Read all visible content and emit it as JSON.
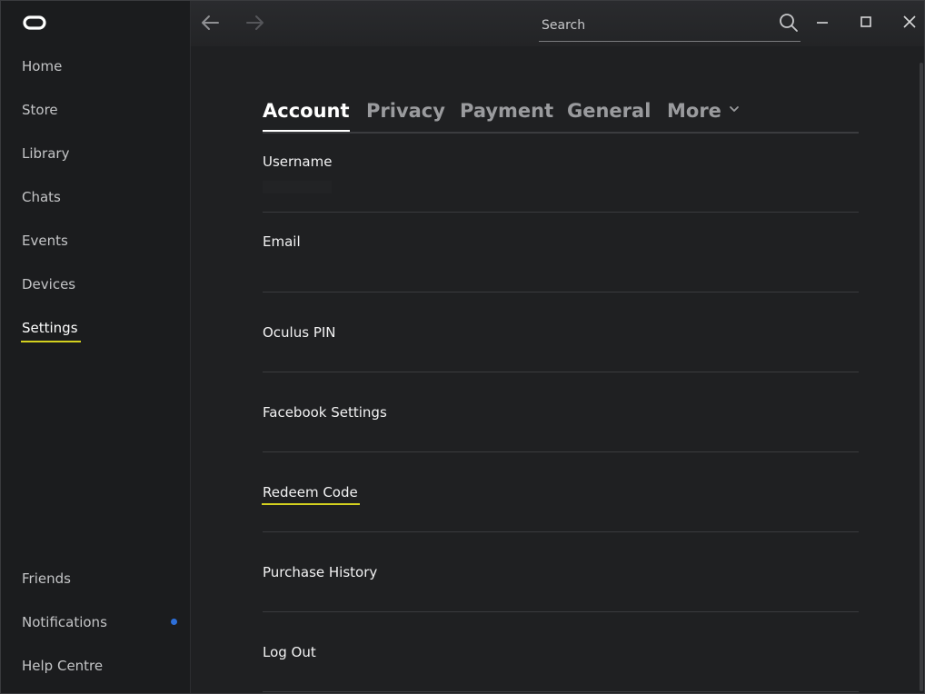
{
  "sidebar": {
    "logo": "oculus-logo",
    "items": [
      {
        "label": "Home"
      },
      {
        "label": "Store"
      },
      {
        "label": "Library"
      },
      {
        "label": "Chats"
      },
      {
        "label": "Events"
      },
      {
        "label": "Devices"
      },
      {
        "label": "Settings",
        "active": true
      }
    ],
    "bottom_items": [
      {
        "label": "Friends"
      },
      {
        "label": "Notifications",
        "has_badge": true
      },
      {
        "label": "Help Centre"
      }
    ]
  },
  "topbar": {
    "back_icon": "arrow-left-icon",
    "forward_icon": "arrow-right-icon",
    "search": {
      "placeholder": "Search",
      "value": ""
    },
    "window_controls": [
      "minimize-icon",
      "maximize-icon",
      "close-icon"
    ]
  },
  "tabs": [
    {
      "label": "Account",
      "active": true
    },
    {
      "label": "Privacy"
    },
    {
      "label": "Payment"
    },
    {
      "label": "General"
    },
    {
      "label": "More",
      "has_dropdown": true
    }
  ],
  "settings_rows": [
    {
      "label": "Username"
    },
    {
      "label": "Email"
    },
    {
      "label": "Oculus PIN"
    },
    {
      "label": "Facebook Settings"
    },
    {
      "label": "Redeem Code",
      "focused": true
    },
    {
      "label": "Purchase History"
    },
    {
      "label": "Log Out"
    }
  ],
  "colors": {
    "accent_underline": "#d4d11f",
    "notification_dot": "#2d6fd9",
    "background": "#1f2022",
    "sidebar": "#1b1c1e"
  }
}
